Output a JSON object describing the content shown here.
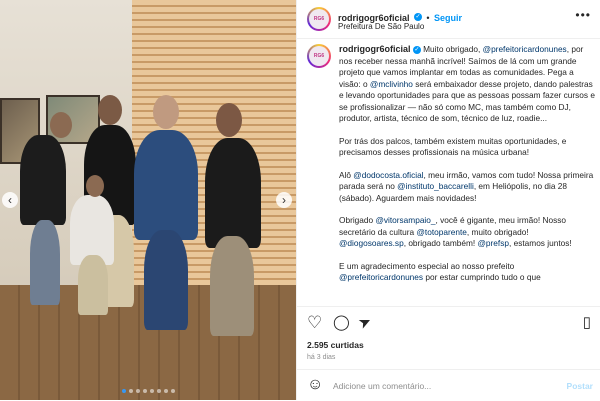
{
  "post": {
    "username": "rodrigogr6oficial",
    "follow_label": "Seguir",
    "location": "Prefeitura De São Paulo",
    "verified_mark": "✓",
    "avatar_text": "RG6",
    "caption_lines": {
      "p1_pre": "Muito obrigado, ",
      "p1_mention": "@prefeitoricardonunes",
      "p1_post": ", por nos receber nessa manhã incrível! Saímos de lá com um grande projeto que vamos implantar em todas as comunidades. Pega a visão: o ",
      "p1_mention2": "@mclivinho",
      "p1_post2": " será embaixador desse projeto, dando palestras e levando oportunidades para que as pessoas possam fazer cursos e se profissionalizar — não só como MC, mas também como DJ, produtor, artista, técnico de som, técnico de luz, roadie...",
      "p2": "Por trás dos palcos, também existem muitas oportunidades, e precisamos desses profissionais na música urbana!",
      "p3_pre": "Alô ",
      "p3_mention": "@dodocosta.oficial",
      "p3_mid": ", meu irmão, vamos com tudo! Nossa primeira parada será no ",
      "p3_mention2": "@instituto_baccarelli",
      "p3_post": ", em Heliópolis, no dia 28 (sábado). Aguardem mais novidades!",
      "p4_pre": "Obrigado ",
      "p4_mention": "@vitorsampaio_",
      "p4_mid": ", você é gigante, meu irmão! Nosso secretário da cultura ",
      "p4_mention2": "@totoparente",
      "p4_mid2": ", muito obrigado! ",
      "p4_mention3": "@diogosoares.sp",
      "p4_mid3": ", obrigado também! ",
      "p4_mention4": "@prefsp",
      "p4_post": ", estamos juntos!",
      "p5_pre": "E um agradecimento especial ao nosso prefeito ",
      "p5_mention": "@prefeitoricardonunes",
      "p5_post": " por estar cumprindo tudo o que"
    },
    "likes": "2.595 curtidas",
    "time": "há 3 dias",
    "comment_placeholder": "Adicione um comentário...",
    "post_label": "Postar"
  },
  "photo": {
    "prev_glyph": "‹",
    "next_glyph": "›",
    "carousel_count": 8,
    "carousel_active": 0
  },
  "icons": {
    "more": "•••",
    "like": "♡",
    "comment": "◯",
    "share": "➤",
    "save": "▯",
    "emoji": "☺"
  },
  "colors": {
    "accent": "#0095f6",
    "link": "#00376b",
    "muted": "#8e8e8e"
  }
}
